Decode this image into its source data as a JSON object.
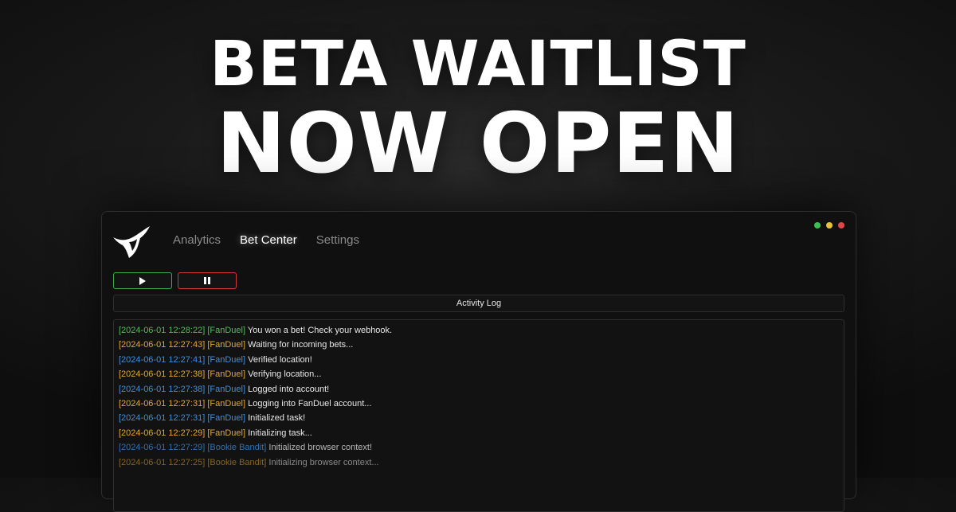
{
  "headline": {
    "line1": "BETA WAITLIST",
    "line2": "NOW OPEN"
  },
  "window": {
    "logo_icon": "horned-bull-logo-icon",
    "nav": [
      {
        "label": "Analytics",
        "active": false
      },
      {
        "label": "Bet Center",
        "active": true
      },
      {
        "label": "Settings",
        "active": false
      }
    ],
    "window_dots": {
      "green": "#3fbf4f",
      "yellow": "#e5c23a",
      "red": "#e04848"
    },
    "controls": {
      "play_icon": "play-icon",
      "pause_icon": "pause-icon",
      "play_border": "#3fa84a",
      "pause_border": "#d23a3a"
    },
    "activity_log": {
      "title": "Activity Log",
      "entries": [
        {
          "timestamp": "[2024-06-01 12:28:22]",
          "source": "[FanDuel]",
          "message": "You won a bet! Check your webhook.",
          "color": "#4fbf5a"
        },
        {
          "timestamp": "[2024-06-01 12:27:43]",
          "source": "[FanDuel]",
          "message": "Waiting for incoming bets...",
          "color": "#e3a72f"
        },
        {
          "timestamp": "[2024-06-01 12:27:41]",
          "source": "[FanDuel]",
          "message": "Verified location!",
          "color": "#3d8fe0"
        },
        {
          "timestamp": "[2024-06-01 12:27:38]",
          "source": "[FanDuel]",
          "message": "Verifying location...",
          "color": "#e3a72f"
        },
        {
          "timestamp": "[2024-06-01 12:27:38]",
          "source": "[FanDuel]",
          "message": "Logged into account!",
          "color": "#3d8fe0"
        },
        {
          "timestamp": "[2024-06-01 12:27:31]",
          "source": "[FanDuel]",
          "message": "Logging into FanDuel account...",
          "color": "#e3a72f"
        },
        {
          "timestamp": "[2024-06-01 12:27:31]",
          "source": "[FanDuel]",
          "message": "Initialized task!",
          "color": "#3d8fe0"
        },
        {
          "timestamp": "[2024-06-01 12:27:29]",
          "source": "[FanDuel]",
          "message": "Initializing task...",
          "color": "#e3a72f"
        },
        {
          "timestamp": "[2024-06-01 12:27:29]",
          "source": "[Bookie Bandit]",
          "message": "Initialized browser context!",
          "color": "#3d8fe0"
        },
        {
          "timestamp": "[2024-06-01 12:27:25]",
          "source": "[Bookie Bandit]",
          "message": "Initializing browser context...",
          "color": "#e3a72f"
        }
      ]
    }
  }
}
